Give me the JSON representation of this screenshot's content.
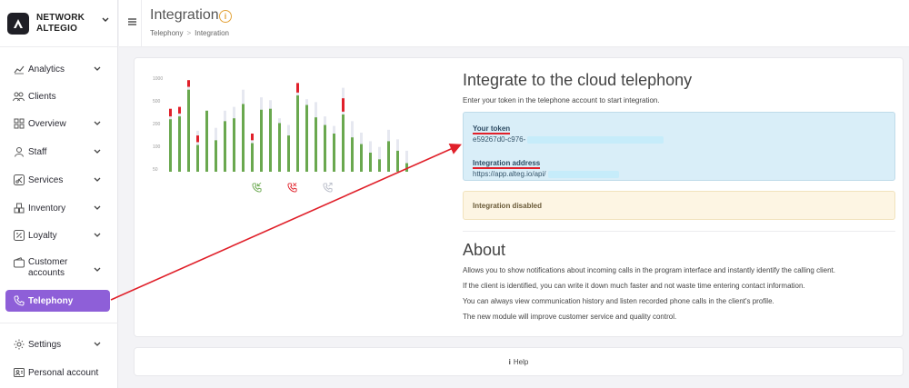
{
  "brand": {
    "name_line1": "NETWORK",
    "name_line2": "ALTEGIO"
  },
  "sidebar": {
    "items": [
      {
        "key": "analytics",
        "label": "Analytics",
        "icon": "chart-icon",
        "chevron": true
      },
      {
        "key": "clients",
        "label": "Clients",
        "icon": "users-icon",
        "chevron": false
      },
      {
        "key": "overview",
        "label": "Overview",
        "icon": "grid-icon",
        "chevron": true
      },
      {
        "key": "staff",
        "label": "Staff",
        "icon": "person-icon",
        "chevron": true
      },
      {
        "key": "services",
        "label": "Services",
        "icon": "scissors-icon",
        "chevron": true
      },
      {
        "key": "inventory",
        "label": "Inventory",
        "icon": "boxes-icon",
        "chevron": true
      },
      {
        "key": "loyalty",
        "label": "Loyalty",
        "icon": "percent-icon",
        "chevron": true
      },
      {
        "key": "customer_accounts",
        "label_line1": "Customer",
        "label_line2": "accounts",
        "icon": "wallet-icon",
        "chevron": true
      },
      {
        "key": "telephony",
        "label": "Telephony",
        "icon": "phone-icon",
        "chevron": false,
        "active": true
      }
    ],
    "bottom": [
      {
        "key": "settings",
        "label": "Settings",
        "icon": "gear-icon",
        "chevron": true
      },
      {
        "key": "personal_account",
        "label": "Personal account",
        "icon": "account-icon",
        "chevron": false
      }
    ]
  },
  "header": {
    "title": "Integration",
    "info_glyph": "i",
    "breadcrumb": [
      "Telephony",
      "Integration"
    ],
    "breadcrumb_sep": ">"
  },
  "main": {
    "title": "Integrate to the cloud telephony",
    "subtitle": "Enter your token in the telephone account to start integration.",
    "token_label": "Your token",
    "token_value": "e59267d0-c976-",
    "address_label": "Integration address",
    "address_value": "https://app.alteg.io/api/",
    "status": "Integration disabled",
    "about_title": "About",
    "about_lines": [
      "Allows you to show notifications about incoming calls in the program interface and instantly identify the calling client.",
      "If the client is identified, you can write it down much faster and not waste time entering contact information.",
      "You can always view communication history and listen recorded phone calls in the client's profile.",
      "The new module will improve customer service and quality control."
    ]
  },
  "illustration": {
    "y_ticks": [
      "1000",
      "500",
      "200",
      "100",
      "50"
    ],
    "colors": {
      "green": "#6aa84f",
      "red": "#e0202a",
      "gray": "#e6e8f0"
    },
    "bars": [
      {
        "g": 0.55,
        "r": 0.08,
        "bg": 0.62
      },
      {
        "g": 0.58,
        "r": 0.07,
        "bg": 0.64
      },
      {
        "g": 0.86,
        "r": 0.07,
        "bg": 0.92
      },
      {
        "g": 0.28,
        "r": 0.07,
        "bg": 0.43
      },
      {
        "g": 0.64,
        "r": 0.0,
        "bg": 0.64
      },
      {
        "g": 0.33,
        "r": 0.0,
        "bg": 0.46
      },
      {
        "g": 0.53,
        "r": 0.0,
        "bg": 0.64
      },
      {
        "g": 0.56,
        "r": 0.0,
        "bg": 0.68
      },
      {
        "g": 0.71,
        "r": 0.0,
        "bg": 0.86
      },
      {
        "g": 0.3,
        "r": 0.07,
        "bg": 0.4
      },
      {
        "g": 0.65,
        "r": 0.0,
        "bg": 0.78
      },
      {
        "g": 0.66,
        "r": 0.0,
        "bg": 0.75
      },
      {
        "g": 0.51,
        "r": 0.0,
        "bg": 0.56
      },
      {
        "g": 0.38,
        "r": 0.0,
        "bg": 0.49
      },
      {
        "g": 0.8,
        "r": 0.1,
        "bg": 0.91
      },
      {
        "g": 0.7,
        "r": 0.0,
        "bg": 0.76
      },
      {
        "g": 0.57,
        "r": 0.0,
        "bg": 0.73
      },
      {
        "g": 0.49,
        "r": 0.0,
        "bg": 0.58
      },
      {
        "g": 0.4,
        "r": 0.0,
        "bg": 0.48
      },
      {
        "g": 0.6,
        "r": 0.14,
        "bg": 0.88
      },
      {
        "g": 0.36,
        "r": 0.0,
        "bg": 0.53
      },
      {
        "g": 0.29,
        "r": 0.0,
        "bg": 0.41
      },
      {
        "g": 0.2,
        "r": 0.0,
        "bg": 0.32
      },
      {
        "g": 0.13,
        "r": 0.0,
        "bg": 0.26
      },
      {
        "g": 0.32,
        "r": 0.0,
        "bg": 0.44
      },
      {
        "g": 0.22,
        "r": 0.0,
        "bg": 0.34
      },
      {
        "g": 0.09,
        "r": 0.0,
        "bg": 0.22
      }
    ],
    "phone_icons": [
      {
        "name": "incoming-call-icon",
        "color": "#6aa84f"
      },
      {
        "name": "missed-call-icon",
        "color": "#e0202a"
      },
      {
        "name": "outgoing-call-icon",
        "color": "#b8bcc8"
      }
    ]
  },
  "help": {
    "glyph": "i",
    "label": "Help"
  },
  "annotation_color": "#e0202a"
}
